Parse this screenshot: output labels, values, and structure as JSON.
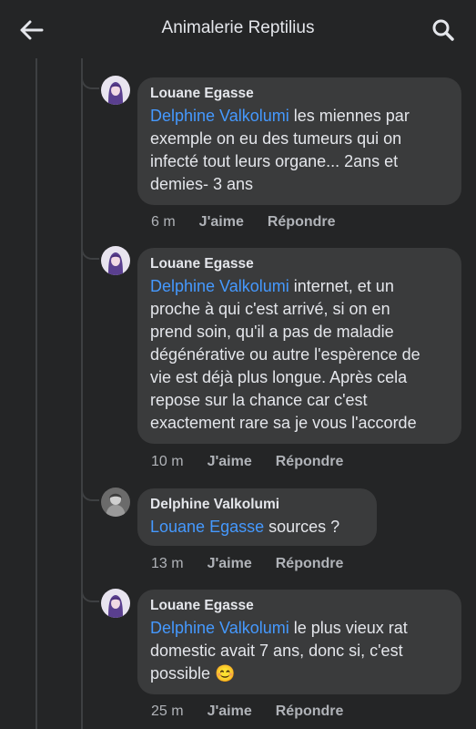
{
  "header": {
    "title": "Animalerie Reptilius",
    "back_icon": "arrow-left-icon",
    "search_icon": "search-icon"
  },
  "colors": {
    "background": "#242526",
    "bubble": "#3a3b3c",
    "mention": "#4599ff",
    "meta": "#b0b3b8"
  },
  "comments": [
    {
      "author": "Louane Egasse",
      "mention": "Delphine Valkolumi",
      "text": " les miennes par\nexemple on eu des tumeurs qui on\ninfecté tout leurs organe... 2ans et\ndemies- 3 ans",
      "time": "6 m",
      "like": "J'aime",
      "reply": "Répondre"
    },
    {
      "author": "Louane Egasse",
      "mention": "Delphine Valkolumi",
      "text": " internet, et un\nproche à qui c'est arrivé, si on en\nprend soin, qu'il a pas de maladie\ndégénérative ou autre l'espèrence de\nvie est déjà plus longue. Après cela\nrepose sur la chance car c'est\nexactement rare sa je vous l'accorde",
      "time": "10 m",
      "like": "J'aime",
      "reply": "Répondre"
    },
    {
      "author": "Delphine Valkolumi",
      "mention": "Louane Egasse",
      "text": " sources ?",
      "time": "13 m",
      "like": "J'aime",
      "reply": "Répondre"
    },
    {
      "author": "Louane Egasse",
      "mention": "Delphine Valkolumi",
      "text": " le plus vieux rat\ndomestic avait 7 ans, donc si, c'est\npossible 😊",
      "time": "25 m",
      "like": "J'aime",
      "reply": "Répondre"
    }
  ]
}
